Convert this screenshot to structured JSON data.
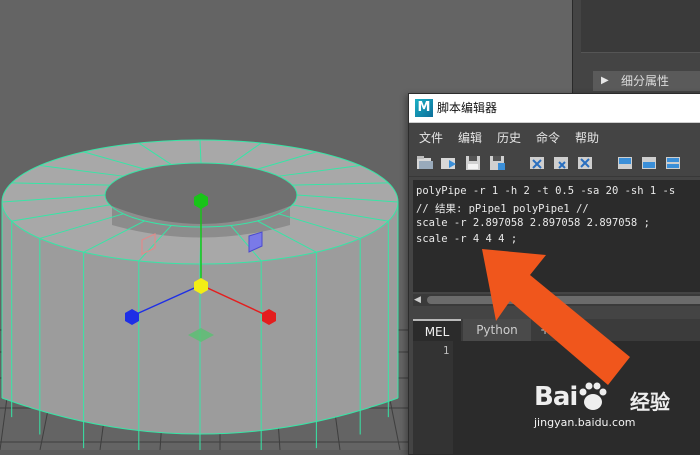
{
  "side_panel": {
    "section_label": "细分属性"
  },
  "script_editor": {
    "title": "脚本编辑器",
    "menu": [
      "文件",
      "编辑",
      "历史",
      "命令",
      "帮助"
    ],
    "toolbar_icons": [
      "open-script-icon",
      "source-script-icon",
      "save-script-icon",
      "save-script-to-shelf-icon",
      "clear-history-icon",
      "clear-input-icon",
      "clear-all-icon",
      "show-history-only-icon",
      "show-input-only-icon",
      "show-both-icon"
    ],
    "history_lines": [
      "polyPipe -r 1 -h 2 -t 0.5 -sa 20 -sh 1 -s",
      "// 结果: pPipe1 polyPipe1 //",
      "scale -r 2.897058 2.897058 2.897058 ;",
      "scale -r 4 4 4 ;"
    ],
    "tabs": {
      "mel": "MEL",
      "python": "Python",
      "add": "+"
    },
    "input_line_number": "1"
  },
  "watermark": {
    "brand_left": "Bai",
    "brand_right": "经验",
    "url": "jingyan.baidu.com"
  },
  "colors": {
    "wireframe": "#36e6a6",
    "mesh_face": "#9a9a9a",
    "annotation_arrow": "#f0561c",
    "move_x": "#e41e1e",
    "move_y": "#18c418",
    "move_z": "#1e2fe6",
    "pivot": "#f3ee14"
  }
}
